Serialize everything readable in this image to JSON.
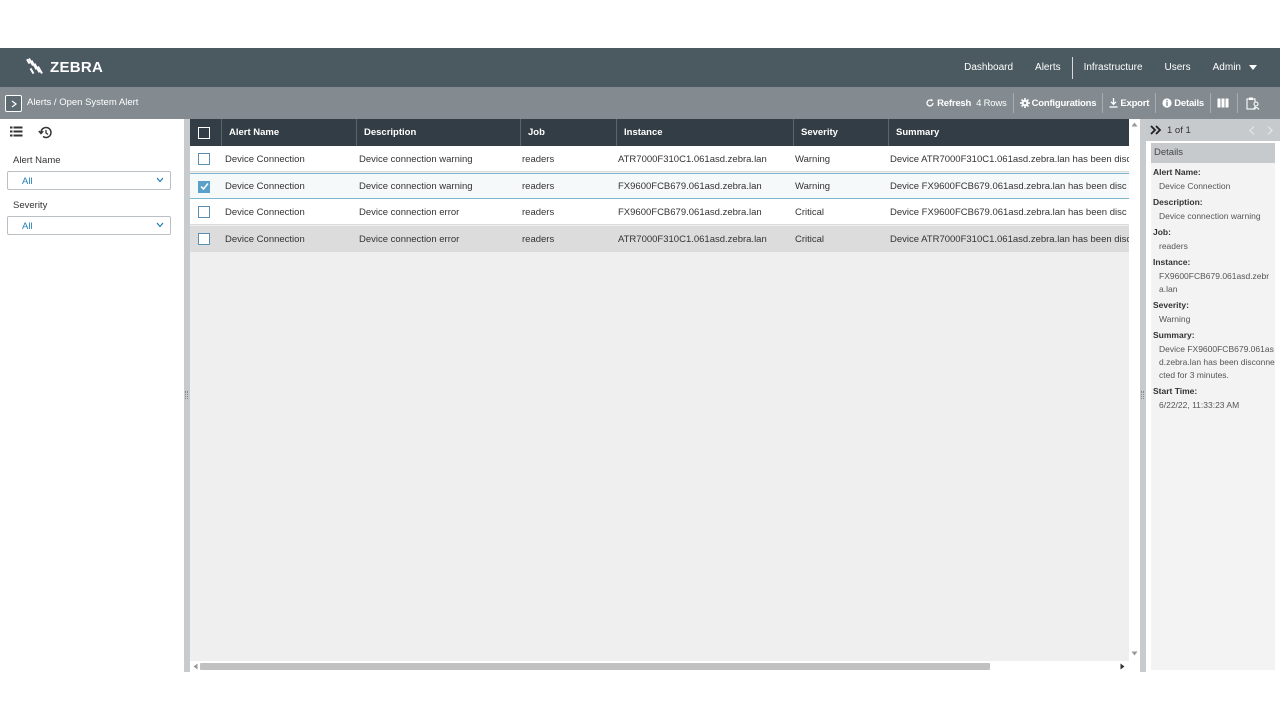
{
  "brand": {
    "name": "ZEBRA"
  },
  "nav": {
    "items": [
      "Dashboard",
      "Alerts",
      "Infrastructure",
      "Users"
    ],
    "user": "Admin"
  },
  "breadcrumb": "Alerts / Open System Alert",
  "toolbar": {
    "refresh": "Refresh",
    "rows": "4 Rows",
    "configurations": "Configurations",
    "export": "Export",
    "details": "Details"
  },
  "filters": {
    "alert_name": {
      "label": "Alert Name",
      "value": "All"
    },
    "severity": {
      "label": "Severity",
      "value": "All"
    }
  },
  "table": {
    "columns": [
      "Alert Name",
      "Description",
      "Job",
      "Instance",
      "Severity",
      "Summary"
    ],
    "rows": [
      {
        "checked": false,
        "alert_name": "Device Connection",
        "description": "Device connection warning",
        "job": "readers",
        "instance": "ATR7000F310C1.061asd.zebra.lan",
        "severity": "Warning",
        "summary": "Device ATR7000F310C1.061asd.zebra.lan has been disc"
      },
      {
        "checked": true,
        "alert_name": "Device Connection",
        "description": "Device connection warning",
        "job": "readers",
        "instance": "FX9600FCB679.061asd.zebra.lan",
        "severity": "Warning",
        "summary": "Device FX9600FCB679.061asd.zebra.lan has been disc"
      },
      {
        "checked": false,
        "alert_name": "Device Connection",
        "description": "Device connection error",
        "job": "readers",
        "instance": "FX9600FCB679.061asd.zebra.lan",
        "severity": "Critical",
        "summary": "Device FX9600FCB679.061asd.zebra.lan has been disc"
      },
      {
        "checked": false,
        "alert_name": "Device Connection",
        "description": "Device connection error",
        "job": "readers",
        "instance": "ATR7000F310C1.061asd.zebra.lan",
        "severity": "Critical",
        "summary": "Device ATR7000F310C1.061asd.zebra.lan has been disc"
      }
    ]
  },
  "details_panel": {
    "pager": "1 of 1",
    "title": "Details",
    "fields": [
      {
        "label": "Alert Name:",
        "value": "Device Connection"
      },
      {
        "label": "Description:",
        "value": "Device connection warning"
      },
      {
        "label": "Job:",
        "value": "readers"
      },
      {
        "label": "Instance:",
        "value": "FX9600FCB679.061asd.zebra.lan"
      },
      {
        "label": "Severity:",
        "value": "Warning"
      },
      {
        "label": "Summary:",
        "value": "Device FX9600FCB679.061asd.zebra.lan has been disconnected for 3 minutes."
      },
      {
        "label": "Start Time:",
        "value": "6/22/22, 11:33:23 AM"
      }
    ]
  },
  "colors": {
    "topnav": "#4b5961",
    "toolbar": "#838b90",
    "grid_header": "#333d45",
    "selected_row": "#f5f9fa",
    "accent": "#5aa0c8"
  }
}
